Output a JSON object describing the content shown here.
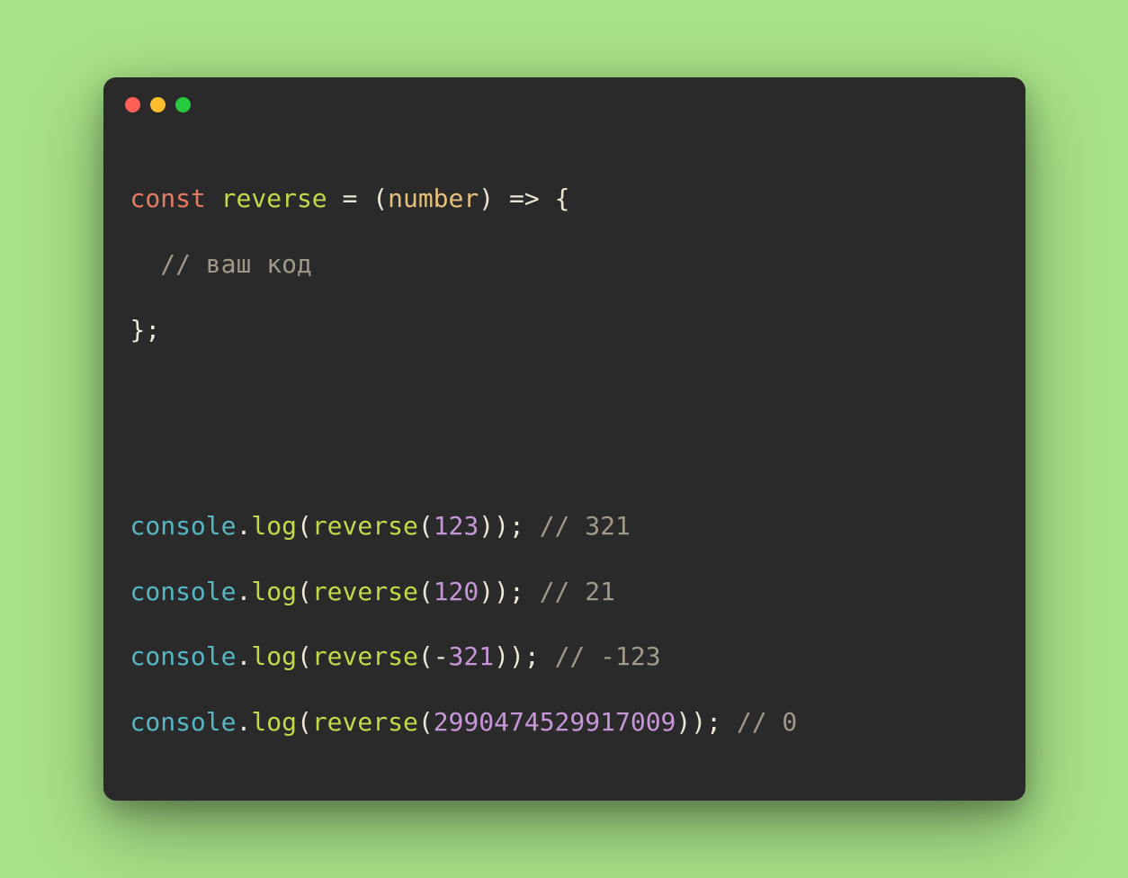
{
  "code": {
    "line1": {
      "kw_const": "const",
      "sp1": " ",
      "fn_name": "reverse",
      "sp2": " ",
      "eq": "=",
      "sp3": " ",
      "lparen": "(",
      "param": "number",
      "rparen": ")",
      "sp4": " ",
      "arrow": "=>",
      "sp5": " ",
      "lbrace": "{"
    },
    "line2": {
      "indent": "  ",
      "comment": "// ваш код"
    },
    "line3": {
      "rbrace_semi": "};"
    },
    "blank1": "",
    "blank2": "",
    "call_lines": [
      {
        "obj": "console",
        "dot": ".",
        "method": "log",
        "lparen": "(",
        "fn": "reverse",
        "lparen2": "(",
        "arg": "123",
        "rparens_semi": "));",
        "sp": " ",
        "comment": "// 321"
      },
      {
        "obj": "console",
        "dot": ".",
        "method": "log",
        "lparen": "(",
        "fn": "reverse",
        "lparen2": "(",
        "arg": "120",
        "rparens_semi": "));",
        "sp": " ",
        "comment": "// 21"
      },
      {
        "obj": "console",
        "dot": ".",
        "method": "log",
        "lparen": "(",
        "fn": "reverse",
        "lparen2": "(",
        "minus": "-",
        "arg": "321",
        "rparens_semi": "));",
        "sp": " ",
        "comment": "// -123"
      },
      {
        "obj": "console",
        "dot": ".",
        "method": "log",
        "lparen": "(",
        "fn": "reverse",
        "lparen2": "(",
        "arg": "2990474529917009",
        "rparens_semi": "));",
        "sp": " ",
        "comment": "// 0"
      }
    ]
  },
  "traffic_lights": {
    "red": "#ff5f56",
    "yellow": "#ffbd2e",
    "green": "#27c93f"
  }
}
